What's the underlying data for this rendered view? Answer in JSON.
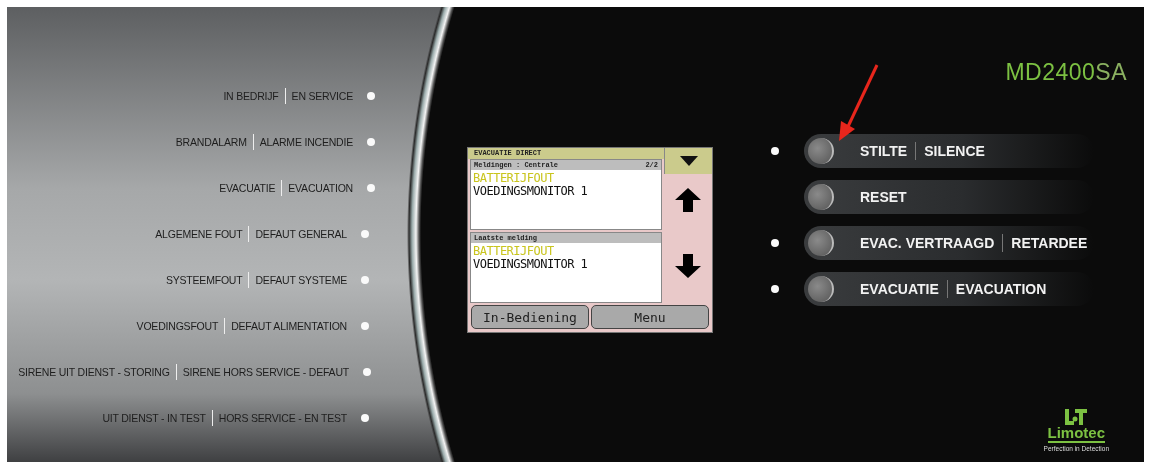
{
  "indicators": [
    {
      "nl": "IN BEDRIJF",
      "fr": "EN SERVICE"
    },
    {
      "nl": "BRANDALARM",
      "fr": "ALARME INCENDIE"
    },
    {
      "nl": "EVACUATIE",
      "fr": "EVACUATION"
    },
    {
      "nl": "ALGEMENE FOUT",
      "fr": "DEFAUT GENERAL"
    },
    {
      "nl": "SYSTEEMFOUT",
      "fr": "DEFAUT SYSTEME"
    },
    {
      "nl": "VOEDINGSFOUT",
      "fr": "DEFAUT ALIMENTATION"
    },
    {
      "nl": "SIRENE UIT DIENST - STORING",
      "fr": "SIRENE HORS SERVICE - DEFAUT"
    },
    {
      "nl": "UIT DIENST - IN TEST",
      "fr": "HORS SERVICE - EN TEST"
    }
  ],
  "lcd": {
    "title": "EVACUATIE DIRECT",
    "panels": [
      {
        "header": "Meldingen : Centrale",
        "page": "2/2",
        "lines": [
          {
            "text": "BATTERIJFOUT",
            "kind": "fault"
          },
          {
            "text": "VOEDINGSMONITOR 1",
            "kind": "normal"
          }
        ]
      },
      {
        "header": "Laatste melding",
        "lines": [
          {
            "text": "BATTERIJFOUT",
            "kind": "fault"
          },
          {
            "text": "VOEDINGSMONITOR 1",
            "kind": "normal"
          }
        ]
      }
    ],
    "buttons": [
      "In-Bediening",
      "Menu"
    ]
  },
  "model": {
    "name": "MD2400",
    "suffix": "SA"
  },
  "controls": [
    {
      "nl": "STILTE",
      "fr": "SILENCE",
      "indicator": true
    },
    {
      "nl": "RESET",
      "indicator": false
    },
    {
      "nl": "EVAC. VERTRAAGD",
      "fr": "RETARDEE",
      "indicator": true
    },
    {
      "nl": "EVACUATIE",
      "fr": "EVACUATION",
      "indicator": true
    }
  ],
  "brand": {
    "name": "Limotec",
    "tagline": "Perfection in Detection"
  }
}
